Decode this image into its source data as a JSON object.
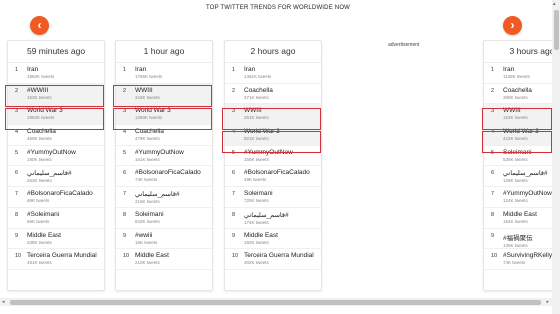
{
  "page": {
    "title": "TOP TWITTER TRENDS FOR WORLDWIDE NOW",
    "advertisement": "advertisement"
  },
  "nav": {
    "prev_icon": "chevron-left-icon",
    "next_icon": "chevron-right-icon",
    "prev_glyph": "‹",
    "next_glyph": "›"
  },
  "colors": {
    "accent": "#f15a22",
    "highlight_border": "#d0303a"
  },
  "scroll": {
    "left": "◂",
    "right": "▸",
    "up": "▴"
  },
  "columns": [
    {
      "header": "59 minutes ago",
      "trends": [
        {
          "rank": "1",
          "name": "Iran",
          "tweets": "1960K tweets"
        },
        {
          "rank": "2",
          "name": "#WWIII",
          "tweets": "163K tweets"
        },
        {
          "rank": "3",
          "name": "World War 3",
          "tweets": "1982K tweets"
        },
        {
          "rank": "4",
          "name": "Coachella",
          "tweets": "460K tweets"
        },
        {
          "rank": "5",
          "name": "#YummyOutNow",
          "tweets": "190K tweets"
        },
        {
          "rank": "6",
          "name": "قاسم_سليماني#",
          "tweets": "263K tweets"
        },
        {
          "rank": "7",
          "name": "#BolsonaroFicaCalado",
          "tweets": "69K tweets"
        },
        {
          "rank": "8",
          "name": "#Soleimani",
          "tweets": "66K tweets"
        },
        {
          "rank": "9",
          "name": "Middle East",
          "tweets": "238K tweets"
        },
        {
          "rank": "10",
          "name": "Terceira Guerra Mundial",
          "tweets": "491K tweets"
        }
      ]
    },
    {
      "header": "1 hour ago",
      "trends": [
        {
          "rank": "1",
          "name": "Iran",
          "tweets": "1756K tweets"
        },
        {
          "rank": "2",
          "name": "WWIII",
          "tweets": "343K tweets"
        },
        {
          "rank": "3",
          "name": "World War 3",
          "tweets": "1280K tweets"
        },
        {
          "rank": "4",
          "name": "Coachella",
          "tweets": "479K tweets"
        },
        {
          "rank": "5",
          "name": "#YummyOutNow",
          "tweets": "161K tweets"
        },
        {
          "rank": "6",
          "name": "#BolsonaroFicaCalado",
          "tweets": "74K tweets"
        },
        {
          "rank": "7",
          "name": "قاسم_سليماني#",
          "tweets": "216K tweets"
        },
        {
          "rank": "8",
          "name": "Soleimani",
          "tweets": "842K tweets"
        },
        {
          "rank": "9",
          "name": "#wwiii",
          "tweets": "16K tweets"
        },
        {
          "rank": "10",
          "name": "Middle East",
          "tweets": "210K tweets"
        }
      ]
    },
    {
      "header": "2 hours ago",
      "trends": [
        {
          "rank": "1",
          "name": "Iran",
          "tweets": "1461K tweets"
        },
        {
          "rank": "2",
          "name": "Coachella",
          "tweets": "371K tweets"
        },
        {
          "rank": "3",
          "name": "WWIII",
          "tweets": "261K tweets"
        },
        {
          "rank": "4",
          "name": "World War 3",
          "tweets": "821K tweets"
        },
        {
          "rank": "5",
          "name": "#YummyOutNow",
          "tweets": "155K tweets"
        },
        {
          "rank": "6",
          "name": "#BolsonaroFicaCalado",
          "tweets": "49K tweets"
        },
        {
          "rank": "7",
          "name": "Soleimani",
          "tweets": "725K tweets"
        },
        {
          "rank": "8",
          "name": "قاسم_سليماني#",
          "tweets": "174K tweets"
        },
        {
          "rank": "9",
          "name": "Middle East",
          "tweets": "192K tweets"
        },
        {
          "rank": "10",
          "name": "Terceira Guerra Mundial",
          "tweets": "302K tweets"
        }
      ]
    },
    {
      "header": "3 hours ago",
      "trends": [
        {
          "rank": "1",
          "name": "Iran",
          "tweets": "1138K tweets"
        },
        {
          "rank": "2",
          "name": "Coachella",
          "tweets": "280K tweets"
        },
        {
          "rank": "3",
          "name": "WWIII",
          "tweets": "153K tweets"
        },
        {
          "rank": "4",
          "name": "World War 3",
          "tweets": "422K tweets"
        },
        {
          "rank": "5",
          "name": "Soleimani",
          "tweets": "536K tweets"
        },
        {
          "rank": "6",
          "name": "قاسم_سليماني#",
          "tweets": "126K tweets"
        },
        {
          "rank": "7",
          "name": "#YummyOutNow",
          "tweets": "124K tweets"
        },
        {
          "rank": "8",
          "name": "Middle East",
          "tweets": "164K tweets"
        },
        {
          "rank": "9",
          "name": "#福禍聚伝",
          "tweets": "130K tweets"
        },
        {
          "rank": "10",
          "name": "#SurvivingRKelly",
          "tweets": "74K tweets"
        }
      ]
    }
  ]
}
